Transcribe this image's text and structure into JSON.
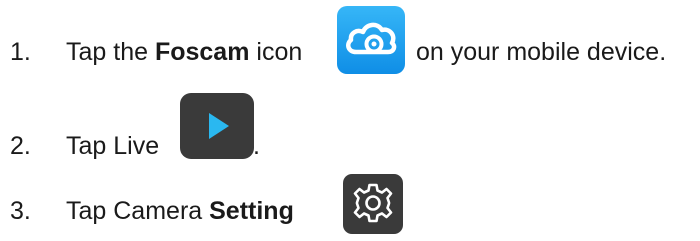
{
  "steps": [
    {
      "number": "1.",
      "pre": "Tap the ",
      "bold": "Foscam",
      "post": " icon",
      "trail": "on your mobile device.",
      "icon": "foscam-cloud-camera-icon",
      "icon_color": "#1aa0f0"
    },
    {
      "number": "2.",
      "pre": "Tap Live",
      "trail": ".",
      "icon": "play-icon",
      "icon_color": "#2ab8f0",
      "icon_bg": "#3a3a3a"
    },
    {
      "number": "3.",
      "pre": "Tap Camera ",
      "bold": "Setting",
      "icon": "gear-icon",
      "icon_bg": "#3a3a3a"
    }
  ]
}
